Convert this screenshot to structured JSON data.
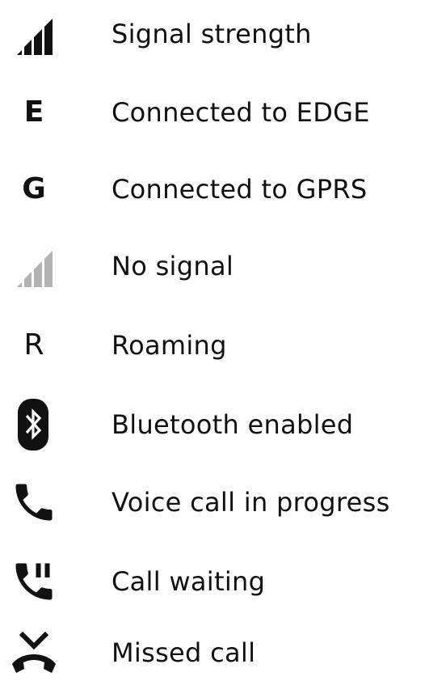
{
  "legend": {
    "items": [
      {
        "icon": "signal-strength-icon",
        "label": "Signal strength"
      },
      {
        "icon": "edge-icon",
        "symbol": "E",
        "label": "Connected to EDGE"
      },
      {
        "icon": "gprs-icon",
        "symbol": "G",
        "label": "Connected to GPRS"
      },
      {
        "icon": "no-signal-icon",
        "label": "No signal"
      },
      {
        "icon": "roaming-icon",
        "symbol": "R",
        "label": "Roaming"
      },
      {
        "icon": "bluetooth-icon",
        "label": "Bluetooth enabled"
      },
      {
        "icon": "phone-handset-icon",
        "label": "Voice call in progress"
      },
      {
        "icon": "call-waiting-icon",
        "label": "Call waiting"
      },
      {
        "icon": "missed-call-icon",
        "label": "Missed call"
      }
    ]
  },
  "colors": {
    "text": "#111111",
    "icon": "#111111",
    "icon_disabled": "#b3b3b3"
  }
}
